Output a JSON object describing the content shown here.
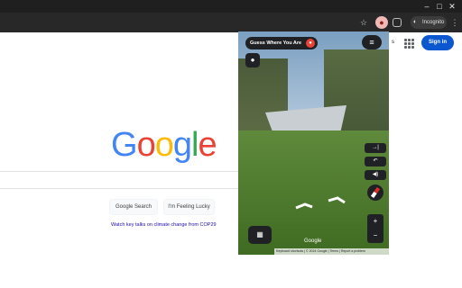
{
  "window": {
    "minimize_glyph": "–",
    "maximize_glyph": "□",
    "close_glyph": "✕"
  },
  "toolbar": {
    "icons": [
      "star-icon",
      "microphone-icon",
      "extension-icon"
    ],
    "incognito_label": "Incognito",
    "menu_glyph": "⋮"
  },
  "google": {
    "partial_text": "s",
    "signin_label": "Sign in",
    "logo_letters": [
      {
        "ch": "G",
        "color": "#4285f4"
      },
      {
        "ch": "o",
        "color": "#ea4335"
      },
      {
        "ch": "o",
        "color": "#fbbc05"
      },
      {
        "ch": "g",
        "color": "#4285f4"
      },
      {
        "ch": "l",
        "color": "#34a853"
      },
      {
        "ch": "e",
        "color": "#ea4335"
      }
    ],
    "search_button": "Google Search",
    "lucky_button": "I'm Feeling Lucky",
    "promo_link": "Watch key talks on climate change from COP29"
  },
  "game": {
    "title": "Guess Where You Are",
    "menu_glyph": "≡",
    "pegman_glyph": "●",
    "controls": {
      "jump_glyph": "→|",
      "undo_glyph": "↶",
      "sound_glyph": "◀)",
      "zoom_in": "+",
      "zoom_out": "−",
      "map_glyph": "▦"
    },
    "watermark": "Google",
    "footer": {
      "shortcuts": "Keyboard shortcuts",
      "copyright": "© 2024 Google",
      "terms": "Terms",
      "report": "Report a problem"
    }
  },
  "colors": {
    "accent_blue": "#0b57d0",
    "chrome_dark": "#1f1f1f",
    "panel_dark": "#202124"
  }
}
